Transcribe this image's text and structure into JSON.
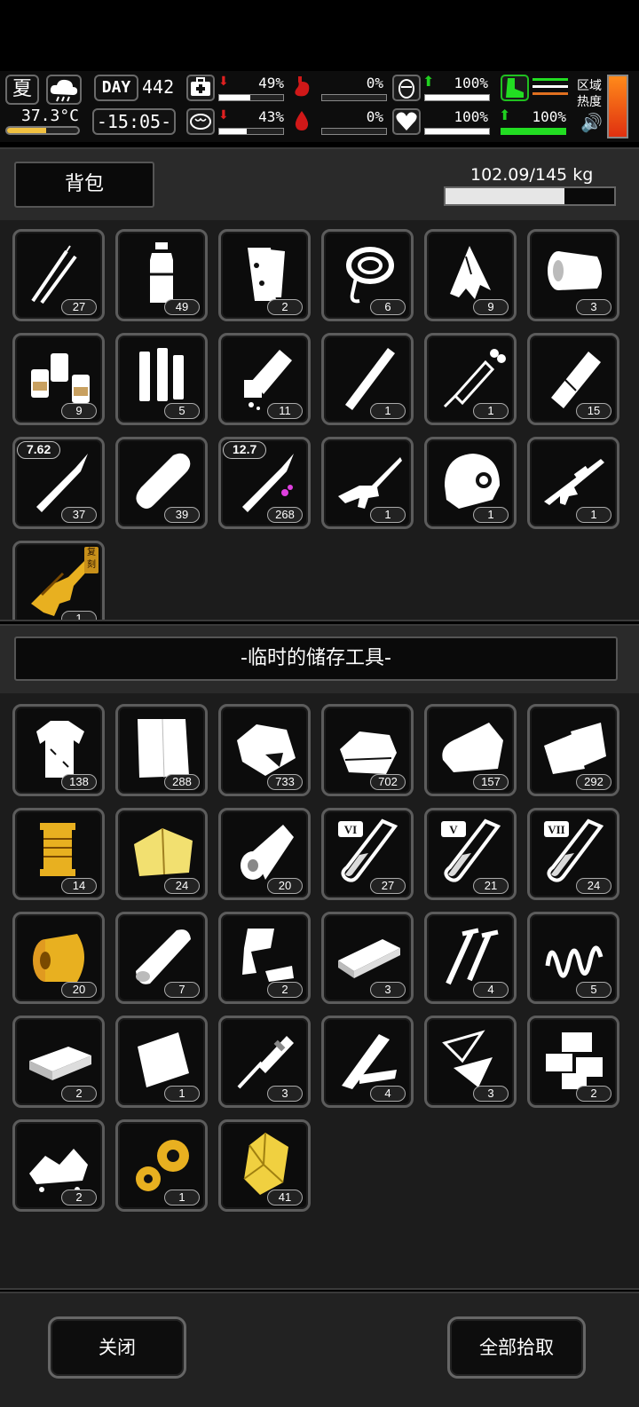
{
  "hud": {
    "season": "夏",
    "weather_icon": "rain-cloud-icon",
    "temperature": "37.3°C",
    "temperature_level": 0.55,
    "day_label": "DAY",
    "day_value": "442",
    "clock": "-15:05-",
    "stats": [
      {
        "icon": "medkit-icon",
        "pct": "49%",
        "level": 0.49,
        "trend": "down",
        "color": "#ffffff"
      },
      {
        "icon": "brain-icon",
        "pct": "43%",
        "level": 0.43,
        "trend": "down",
        "color": "#ffffff"
      },
      {
        "icon": "stomach-icon",
        "pct": "0%",
        "level": 0.0,
        "trend": "none",
        "color": "#ffffff"
      },
      {
        "icon": "water-drop-icon",
        "pct": "0%",
        "level": 0.0,
        "trend": "none",
        "color": "#ffffff"
      },
      {
        "icon": "bladder-icon",
        "pct": "100%",
        "level": 1.0,
        "trend": "up",
        "color": "#ffffff"
      },
      {
        "icon": "heart-icon",
        "pct": "100%",
        "level": 1.0,
        "trend": "none",
        "color": "#ffffff"
      },
      {
        "icon": "boot-icon",
        "pct": "100%",
        "level": 1.0,
        "trend": "up",
        "color": "#22dd22"
      }
    ],
    "region_label_1": "区域",
    "region_label_2": "热度",
    "speaker_icon": "speaker-icon"
  },
  "backpack": {
    "title": "背包",
    "weight": "102.09/145 kg",
    "weight_level": 0.704,
    "items": [
      {
        "name": "lockpick-icon",
        "count": "27"
      },
      {
        "name": "water-bottle-icon",
        "count": "49"
      },
      {
        "name": "bandage-roll-icon",
        "count": "2"
      },
      {
        "name": "rope-icon",
        "count": "6"
      },
      {
        "name": "torn-cloth-icon",
        "count": "9"
      },
      {
        "name": "towel-roll-icon",
        "count": "3"
      },
      {
        "name": "pill-bottles-icon",
        "count": "9"
      },
      {
        "name": "batteries-icon",
        "count": "5"
      },
      {
        "name": "spilled-bottle-icon",
        "count": "11"
      },
      {
        "name": "stick-icon",
        "count": "1"
      },
      {
        "name": "syringe-icon",
        "count": "1"
      },
      {
        "name": "wrapped-bar-icon",
        "count": "15"
      },
      {
        "name": "bullet-icon",
        "count": "37",
        "caliber": "7.62"
      },
      {
        "name": "bread-icon",
        "count": "39"
      },
      {
        "name": "bullet-icon",
        "count": "268",
        "caliber": "12.7"
      },
      {
        "name": "assault-rifle-icon",
        "count": "1"
      },
      {
        "name": "helmet-icon",
        "count": "1"
      },
      {
        "name": "sniper-rifle-icon",
        "count": "1"
      },
      {
        "name": "golden-gun-icon",
        "count": "1",
        "badge": "复刻"
      }
    ]
  },
  "storage": {
    "title": "-临时的储存工具-",
    "items": [
      {
        "name": "ragged-shirt-icon",
        "count": "138"
      },
      {
        "name": "cloth-sheet-icon",
        "count": "288"
      },
      {
        "name": "torn-bag-icon",
        "count": "733"
      },
      {
        "name": "folded-cloth-icon",
        "count": "702"
      },
      {
        "name": "blanket-icon",
        "count": "157"
      },
      {
        "name": "cloth-scraps-icon",
        "count": "292"
      },
      {
        "name": "thread-spool-icon",
        "count": "14"
      },
      {
        "name": "gold-fabric-icon",
        "count": "24"
      },
      {
        "name": "paper-roll-icon",
        "count": "20"
      },
      {
        "name": "test-tube-vi-icon",
        "count": "27",
        "tag": "VI"
      },
      {
        "name": "test-tube-v-icon",
        "count": "21",
        "tag": "V"
      },
      {
        "name": "test-tube-vii-icon",
        "count": "24",
        "tag": "VII"
      },
      {
        "name": "gold-spool-icon",
        "count": "20"
      },
      {
        "name": "log-icon",
        "count": "7"
      },
      {
        "name": "scrap-metal-icon",
        "count": "2"
      },
      {
        "name": "plank-icon",
        "count": "3"
      },
      {
        "name": "screws-icon",
        "count": "4"
      },
      {
        "name": "spring-icon",
        "count": "5"
      },
      {
        "name": "cash-stack-icon",
        "count": "2"
      },
      {
        "name": "metal-sheet-icon",
        "count": "1"
      },
      {
        "name": "drill-bit-icon",
        "count": "3"
      },
      {
        "name": "broken-wood-icon",
        "count": "4"
      },
      {
        "name": "glass-shards-icon",
        "count": "3"
      },
      {
        "name": "bricks-icon",
        "count": "2"
      },
      {
        "name": "rubble-icon",
        "count": "2"
      },
      {
        "name": "gears-icon",
        "count": "1"
      },
      {
        "name": "gold-crystal-icon",
        "count": "41"
      }
    ]
  },
  "footer": {
    "close_label": "关闭",
    "take_all_label": "全部拾取"
  }
}
